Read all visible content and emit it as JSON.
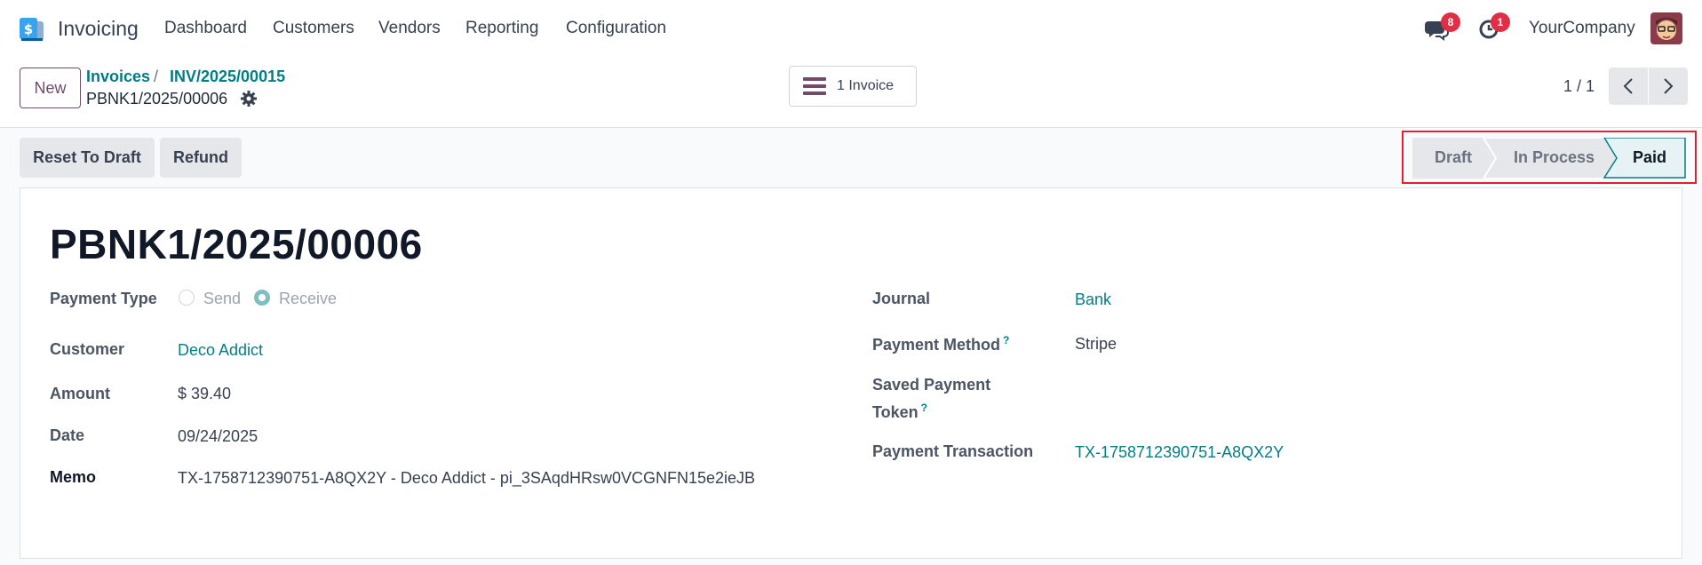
{
  "app": {
    "name": "Invoicing"
  },
  "nav": [
    "Dashboard",
    "Customers",
    "Vendors",
    "Reporting",
    "Configuration"
  ],
  "topbar": {
    "messages_badge": "8",
    "activities_badge": "1",
    "company": "YourCompany"
  },
  "control_panel": {
    "new_label": "New",
    "breadcrumb": [
      "Invoices",
      "INV/2025/00015"
    ],
    "breadcrumb_sep": "/",
    "current_record": "PBNK1/2025/00006",
    "smart_button_label": "1 Invoice",
    "pager": "1 / 1"
  },
  "actions": {
    "reset_label": "Reset To Draft",
    "refund_label": "Refund"
  },
  "statusbar": {
    "stages": [
      "Draft",
      "In Process",
      "Paid"
    ],
    "active": "Paid"
  },
  "form": {
    "title": "PBNK1/2025/00006",
    "payment_type_label": "Payment Type",
    "payment_type_options": [
      "Send",
      "Receive"
    ],
    "payment_type_selected": "Receive",
    "customer_label": "Customer",
    "customer_value": "Deco Addict",
    "amount_label": "Amount",
    "amount_value": "$ 39.40",
    "date_label": "Date",
    "date_value": "09/24/2025",
    "memo_label": "Memo",
    "memo_value": "TX-1758712390751-A8QX2Y - Deco Addict - pi_3SAqdHRsw0VCGNFN15e2ieJB",
    "journal_label": "Journal",
    "journal_value": "Bank",
    "payment_method_label": "Payment Method",
    "payment_method_help": "?",
    "payment_method_value": "Stripe",
    "token_label_line1": "Saved Payment",
    "token_label_line2": "Token",
    "token_help": "?",
    "transaction_label": "Payment Transaction",
    "transaction_value": "TX-1758712390751-A8QX2Y"
  },
  "colors": {
    "brand": "#714b67",
    "link": "#017e84",
    "badge": "#e02f45",
    "highlight_outline": "#e0202f"
  }
}
